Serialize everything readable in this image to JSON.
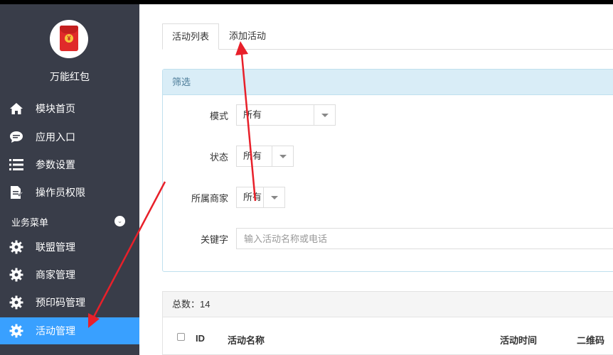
{
  "sidebar": {
    "app_name": "万能红包",
    "logo_icon": "red-envelope-icon",
    "items": [
      {
        "label": "模块首页",
        "icon": "home-icon"
      },
      {
        "label": "应用入口",
        "icon": "chat-icon"
      },
      {
        "label": "参数设置",
        "icon": "list-icon"
      },
      {
        "label": "操作员权限",
        "icon": "document-edit-icon"
      }
    ],
    "section_label": "业务菜单",
    "business_items": [
      {
        "label": "联盟管理",
        "icon": "gear-icon"
      },
      {
        "label": "商家管理",
        "icon": "gear-icon"
      },
      {
        "label": "预印码管理",
        "icon": "gear-icon"
      },
      {
        "label": "活动管理",
        "icon": "gear-icon",
        "active": true
      }
    ],
    "active_color": "#39a0ff",
    "bg_color": "#393d49"
  },
  "tabs": [
    {
      "label": "活动列表",
      "active": true
    },
    {
      "label": "添加活动",
      "active": false
    }
  ],
  "filter": {
    "title": "筛选",
    "mode_label": "模式",
    "mode_value": "所有",
    "status_label": "状态",
    "status_value": "所有",
    "merchant_label": "所属商家",
    "merchant_value": "所有",
    "keyword_label": "关键字",
    "keyword_placeholder": "输入活动名称或电话"
  },
  "table": {
    "total_text": "总数：14",
    "columns": [
      "ID",
      "活动名称",
      "活动时间",
      "二维码"
    ]
  },
  "annotation_color": "#e8202a"
}
